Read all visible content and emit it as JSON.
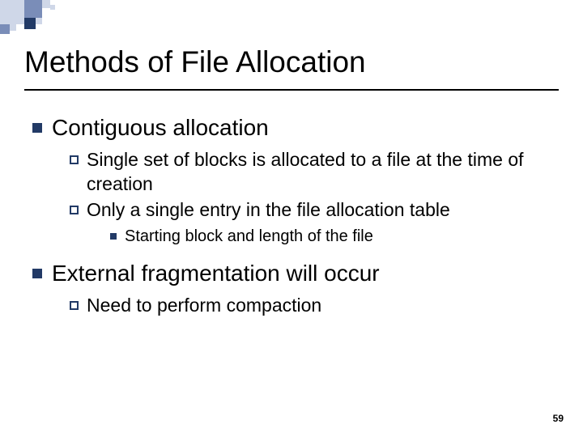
{
  "title": "Methods of File Allocation",
  "bullets": [
    {
      "text": "Contiguous allocation",
      "sub": [
        {
          "text": "Single set of blocks is allocated to a file at the time of creation"
        },
        {
          "text": "Only a single entry in the file allocation table",
          "sub": [
            {
              "text": "Starting block and length of the file"
            }
          ]
        }
      ]
    },
    {
      "text": "External fragmentation will occur",
      "sub": [
        {
          "text": "Need to perform compaction"
        }
      ]
    }
  ],
  "page_number": "59",
  "colors": {
    "accent_dark": "#223a66",
    "accent_mid": "#7a8db8",
    "accent_light": "#cfd7e8"
  }
}
